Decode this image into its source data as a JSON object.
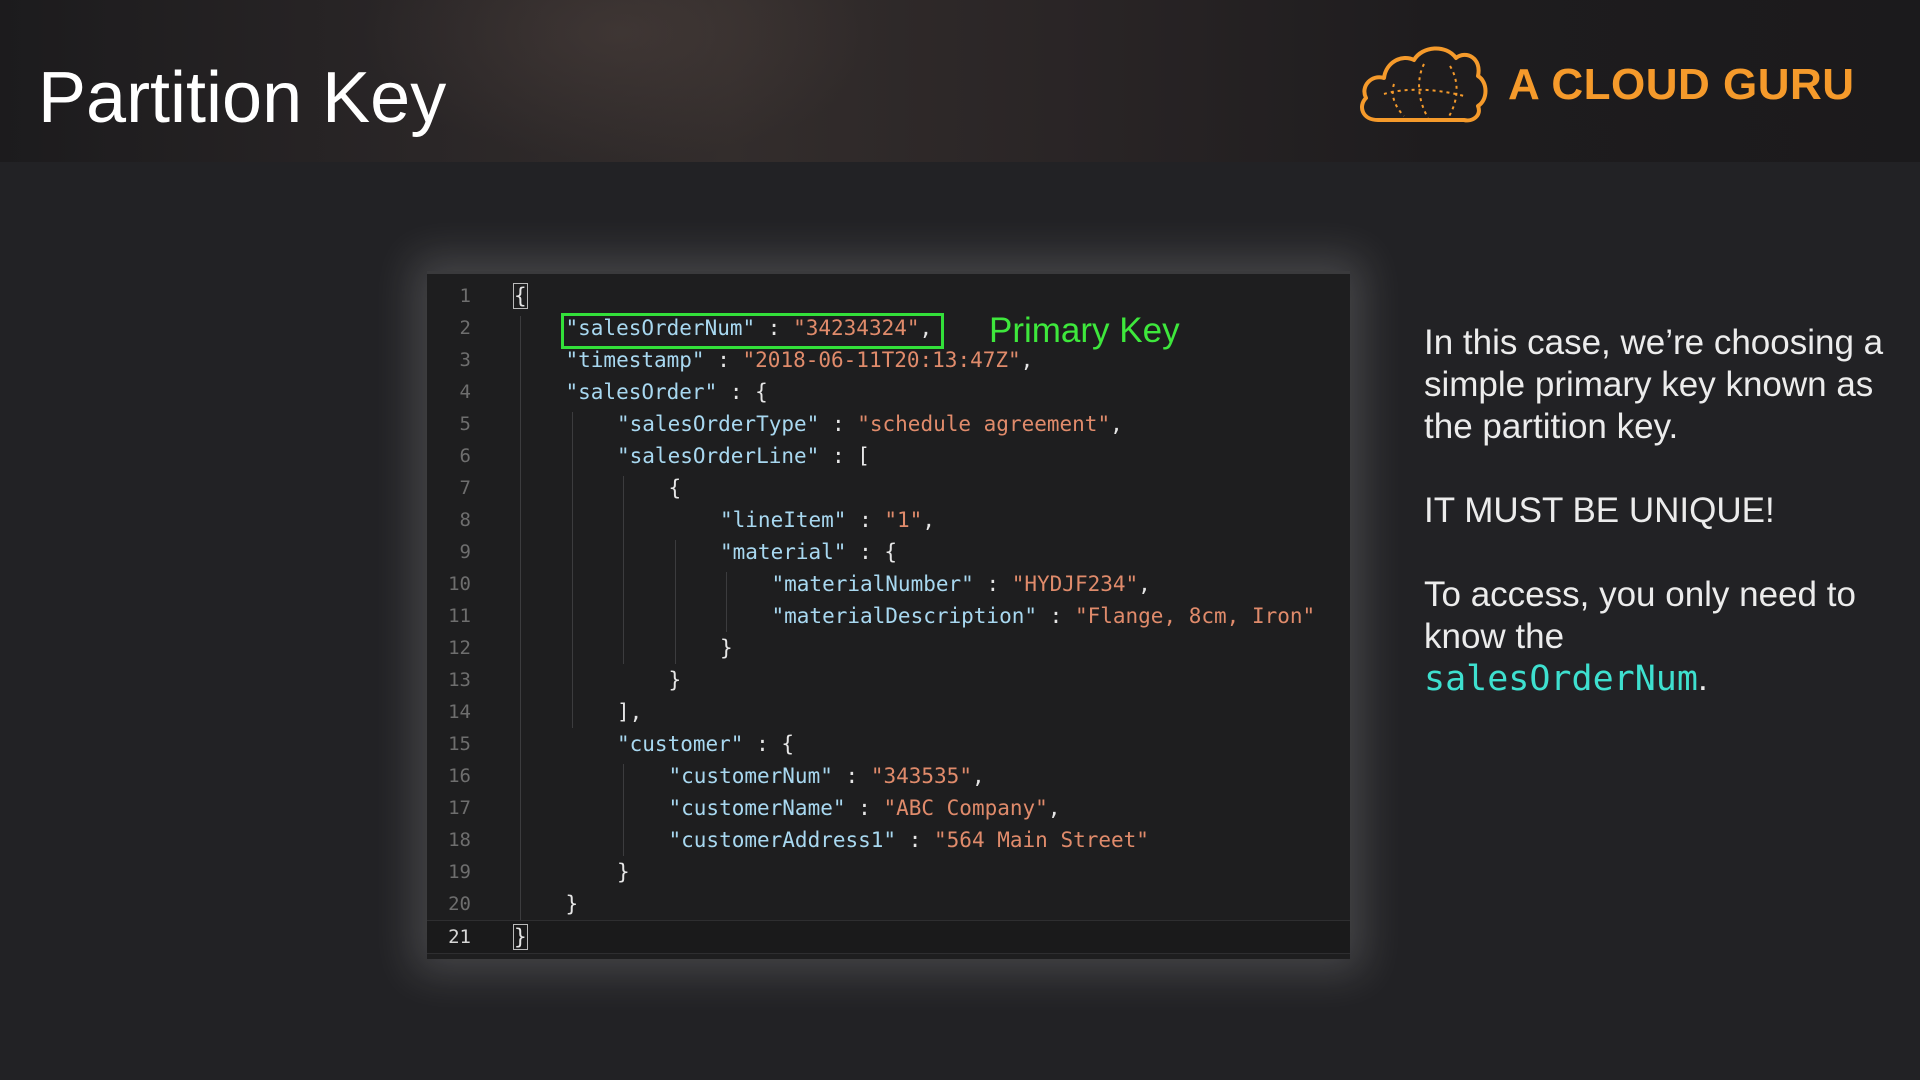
{
  "slide": {
    "title": "Partition Key"
  },
  "logo": {
    "text": "A CLOUD GURU",
    "icon": "cloud-icon",
    "color": "#f59a2b"
  },
  "code": {
    "active_line": 21,
    "lines": [
      {
        "n": "1",
        "indent": 0,
        "tokens": [
          {
            "t": "brace-box",
            "v": "{"
          }
        ]
      },
      {
        "n": "2",
        "indent": 1,
        "tokens": [
          {
            "t": "key",
            "v": "\"salesOrderNum\""
          },
          {
            "t": "pun",
            "v": " : "
          },
          {
            "t": "str",
            "v": "\"34234324\""
          },
          {
            "t": "pun",
            "v": ","
          }
        ]
      },
      {
        "n": "3",
        "indent": 1,
        "tokens": [
          {
            "t": "key",
            "v": "\"timestamp\""
          },
          {
            "t": "pun",
            "v": " : "
          },
          {
            "t": "str",
            "v": "\"2018-06-11T20:13:47Z\""
          },
          {
            "t": "pun",
            "v": ","
          }
        ]
      },
      {
        "n": "4",
        "indent": 1,
        "tokens": [
          {
            "t": "key",
            "v": "\"salesOrder\""
          },
          {
            "t": "pun",
            "v": " : {"
          }
        ]
      },
      {
        "n": "5",
        "indent": 2,
        "tokens": [
          {
            "t": "key",
            "v": "\"salesOrderType\""
          },
          {
            "t": "pun",
            "v": " : "
          },
          {
            "t": "str",
            "v": "\"schedule agreement\""
          },
          {
            "t": "pun",
            "v": ","
          }
        ]
      },
      {
        "n": "6",
        "indent": 2,
        "tokens": [
          {
            "t": "key",
            "v": "\"salesOrderLine\""
          },
          {
            "t": "pun",
            "v": " : ["
          }
        ]
      },
      {
        "n": "7",
        "indent": 3,
        "tokens": [
          {
            "t": "pun",
            "v": "{"
          }
        ]
      },
      {
        "n": "8",
        "indent": 4,
        "tokens": [
          {
            "t": "key",
            "v": "\"lineItem\""
          },
          {
            "t": "pun",
            "v": " : "
          },
          {
            "t": "str",
            "v": "\"1\""
          },
          {
            "t": "pun",
            "v": ","
          }
        ]
      },
      {
        "n": "9",
        "indent": 4,
        "tokens": [
          {
            "t": "key",
            "v": "\"material\""
          },
          {
            "t": "pun",
            "v": " : {"
          }
        ]
      },
      {
        "n": "10",
        "indent": 5,
        "tokens": [
          {
            "t": "key",
            "v": "\"materialNumber\""
          },
          {
            "t": "pun",
            "v": " : "
          },
          {
            "t": "str",
            "v": "\"HYDJF234\""
          },
          {
            "t": "pun",
            "v": ","
          }
        ]
      },
      {
        "n": "11",
        "indent": 5,
        "tokens": [
          {
            "t": "key",
            "v": "\"materialDescription\""
          },
          {
            "t": "pun",
            "v": " : "
          },
          {
            "t": "str",
            "v": "\"Flange, 8cm, Iron\""
          }
        ]
      },
      {
        "n": "12",
        "indent": 4,
        "tokens": [
          {
            "t": "pun",
            "v": "}"
          }
        ]
      },
      {
        "n": "13",
        "indent": 3,
        "tokens": [
          {
            "t": "pun",
            "v": "}"
          }
        ]
      },
      {
        "n": "14",
        "indent": 2,
        "tokens": [
          {
            "t": "pun",
            "v": "],"
          }
        ]
      },
      {
        "n": "15",
        "indent": 2,
        "tokens": [
          {
            "t": "key",
            "v": "\"customer\""
          },
          {
            "t": "pun",
            "v": " : {"
          }
        ]
      },
      {
        "n": "16",
        "indent": 3,
        "tokens": [
          {
            "t": "key",
            "v": "\"customerNum\""
          },
          {
            "t": "pun",
            "v": " : "
          },
          {
            "t": "str",
            "v": "\"343535\""
          },
          {
            "t": "pun",
            "v": ","
          }
        ]
      },
      {
        "n": "17",
        "indent": 3,
        "tokens": [
          {
            "t": "key",
            "v": "\"customerName\""
          },
          {
            "t": "pun",
            "v": " : "
          },
          {
            "t": "str",
            "v": "\"ABC Company\""
          },
          {
            "t": "pun",
            "v": ","
          }
        ]
      },
      {
        "n": "18",
        "indent": 3,
        "tokens": [
          {
            "t": "key",
            "v": "\"customerAddress1\""
          },
          {
            "t": "pun",
            "v": " : "
          },
          {
            "t": "str",
            "v": "\"564 Main Street\""
          }
        ]
      },
      {
        "n": "19",
        "indent": 2,
        "tokens": [
          {
            "t": "pun",
            "v": "}"
          }
        ]
      },
      {
        "n": "20",
        "indent": 1,
        "tokens": [
          {
            "t": "pun",
            "v": "}"
          }
        ]
      },
      {
        "n": "21",
        "indent": 0,
        "tokens": [
          {
            "t": "brace-box",
            "v": "}"
          }
        ]
      }
    ]
  },
  "annotation": {
    "label": "Primary Key",
    "color": "#3ee83c"
  },
  "explanation": {
    "line1": "In this case, we’re choosing a simple primary key known as the partition key.",
    "line2": "IT MUST BE UNIQUE!",
    "line3_prefix": "To access, you only need to know the",
    "line3_code": "salesOrderNum",
    "line3_suffix": "."
  }
}
